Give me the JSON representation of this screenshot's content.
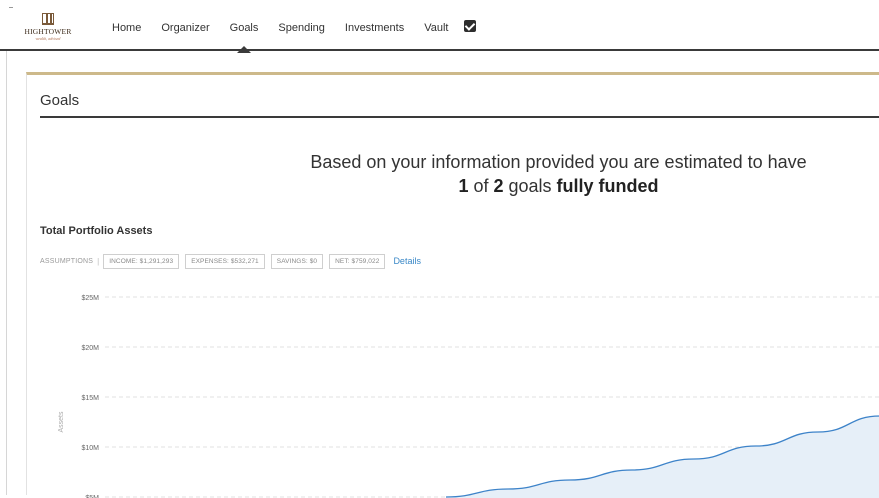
{
  "app": {
    "logo_name": "HIGHTOWER",
    "logo_tagline": "wealth, advised"
  },
  "nav": {
    "items": [
      {
        "label": "Home",
        "active": false
      },
      {
        "label": "Organizer",
        "active": false
      },
      {
        "label": "Goals",
        "active": true
      },
      {
        "label": "Spending",
        "active": false
      },
      {
        "label": "Investments",
        "active": false
      },
      {
        "label": "Vault",
        "active": false
      }
    ],
    "checkbox_icon": "checkbox-checked-icon"
  },
  "page": {
    "title": "Goals"
  },
  "summary": {
    "line1": "Based on your information provided you are estimated to have",
    "funded_count": "1",
    "of_text": " of ",
    "total_goals": "2",
    "goals_text": " goals ",
    "status_text": "fully funded"
  },
  "section": {
    "title": "Total Portfolio Assets"
  },
  "assumptions": {
    "label": "ASSUMPTIONS",
    "separator": "|",
    "chips": [
      "INCOME: $1,291,293",
      "EXPENSES: $532,271",
      "SAVINGS: $0",
      "NET: $759,022"
    ],
    "details_label": "Details"
  },
  "chart_data": {
    "type": "area",
    "title": "",
    "ylabel": "Assets",
    "xlabel": "",
    "ylim": [
      0,
      25000000
    ],
    "y_ticks": [
      "$25M",
      "$20M",
      "$15M",
      "$10M",
      "$5M"
    ],
    "y_tick_values": [
      25000000,
      20000000,
      15000000,
      10000000,
      5000000
    ],
    "grid": true,
    "series": [
      {
        "x": [
          0.44,
          0.52,
          0.6,
          0.68,
          0.76,
          0.84,
          0.92,
          1.0
        ],
        "values": [
          5000000,
          5800000,
          6700000,
          7700000,
          8800000,
          10100000,
          11500000,
          13100000
        ]
      }
    ],
    "colors": {
      "line": "#3d83c9",
      "fill": "#e6eff8",
      "grid": "#e0e0e0"
    }
  }
}
